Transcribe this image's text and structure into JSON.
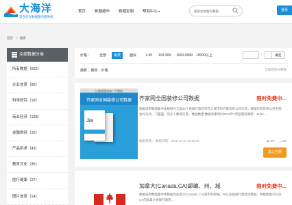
{
  "header": {
    "logo_title": "大海洋",
    "logo_subtitle": "适合您大数据服务提供商",
    "nav": [
      "首页",
      "数据超市",
      "数据定制",
      "帮助中心"
    ],
    "search_placeholder": "搜索您想要的数据",
    "login_label": "登录"
  },
  "breadcrumb": [
    "首页",
    "/",
    "搜索"
  ],
  "sidebar": {
    "heading": "全部数据分类",
    "items": [
      {
        "label": "所有数据（562）"
      },
      {
        "label": "企业信息（86）"
      },
      {
        "label": "科学研究（18）"
      },
      {
        "label": "商业经济（138）"
      },
      {
        "label": "金融财经（16）"
      },
      {
        "label": "产品供求（43）"
      },
      {
        "label": "教育文化（35）"
      },
      {
        "label": "医疗健康（27）"
      },
      {
        "label": "图片信息（14）"
      }
    ]
  },
  "filter": {
    "price_label": "价格：",
    "price_options": [
      "全部",
      "免费",
      "面议",
      "1-99",
      "100-999",
      "1000-9999",
      "10000以上"
    ],
    "active_price": "免费",
    "range_separator": "-",
    "confirm_label": "确定",
    "sort_options": [
      "最新",
      "最热",
      "价格"
    ],
    "result_text": "当前找到",
    "result_count": "8",
    "result_unit": "数据"
  },
  "results": [
    {
      "thumb_topline": "让数据服务每一件事物",
      "thumb_banner": "齐家网全国装修公司数据",
      "thumb_logo": "Jia",
      "title": "齐家网全国装修公司数据",
      "promo": "限时免费中...",
      "description": "数据说明数据集中本数据为全国34个省级行政区内在大城市的齐家装修公司信息，数据包括装修公司名称、合同与约、门面面、购买人数等信息。数据数量:数据采集时间2015年7月至最近更新：&nbs...",
      "meta": "数据来源：    数据日期：2015-11-10 16:53:48",
      "views": "487",
      "downloads": "128",
      "cart_label": "加入已购"
    },
    {
      "title": "加拿大(Canada,CA)邮编、州、城",
      "promo": "限时免费中...",
      "description": "数据说明数据集中本数据为加拿大(Canada, CA)城市的邮编，州以及省级行政区域数据，数据数量只包含CA的加拿大省级行政区…"
    }
  ],
  "colors": {
    "accent": "#1a8fd8",
    "promo": "#e8371b",
    "cart": "#f39a1e",
    "sidebar_head": "#5a5f63"
  }
}
